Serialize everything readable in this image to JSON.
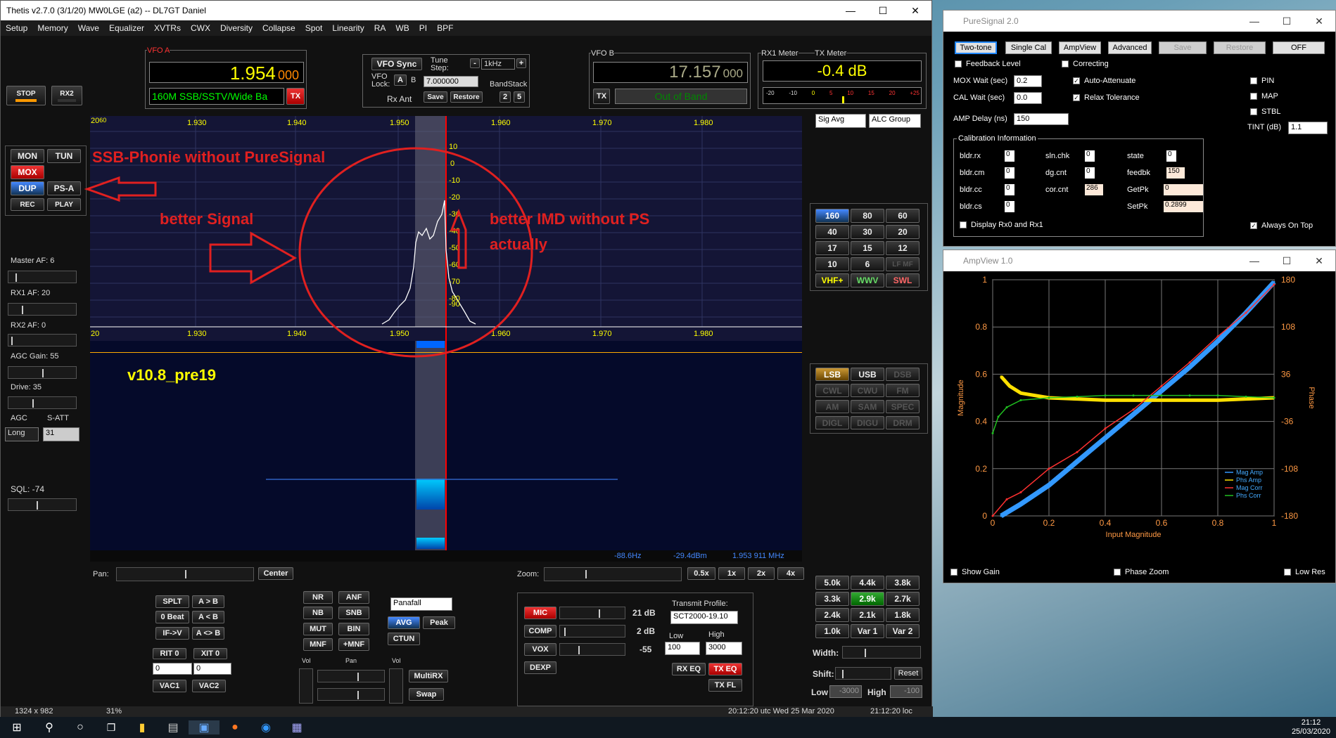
{
  "main": {
    "title": "Thetis v2.7.0 (3/1/20) MW0LGE (a2)  --  DL7GT Daniel",
    "menu": [
      "Setup",
      "Memory",
      "Wave",
      "Equalizer",
      "XVTRs",
      "CWX",
      "Diversity",
      "Collapse",
      "Spot",
      "Linearity",
      "RA",
      "WB",
      "PI",
      "BPF"
    ]
  },
  "vfoa": {
    "label": "VFO A",
    "freq": "1.954",
    "sub": "000",
    "band": "160M SSB/SSTV/Wide Ba",
    "tx": "TX"
  },
  "vfob": {
    "label": "VFO B",
    "freq": "17.157",
    "sub": "000",
    "band": "Out of Band",
    "tx": "TX"
  },
  "center": {
    "vfo_sync": "VFO Sync",
    "tune_step_label": "Tune Step:",
    "tune_step": "1kHz",
    "vfo_lock": "VFO Lock:",
    "a": "A",
    "b": "B",
    "freq_field": "7.000000",
    "bandstack": "BandStack",
    "rx_ant": "Rx Ant",
    "save": "Save",
    "restore": "Restore",
    "n2": "2",
    "n5": "5"
  },
  "meter": {
    "rx1": "RX1 Meter",
    "tx": "TX Meter",
    "value": "-0.4 dB",
    "scale": [
      "-20",
      "-10",
      "0",
      "5",
      "10",
      "15",
      "20",
      "+25"
    ],
    "sig": "Sig Avg",
    "alc": "ALC Group"
  },
  "left": {
    "stop": "STOP",
    "rx2": "RX2",
    "mon": "MON",
    "tun": "TUN",
    "mox": "MOX",
    "dup": "DUP",
    "psa": "PS-A",
    "rec": "REC",
    "play": "PLAY",
    "master_af": "Master AF:  6",
    "rx1_af": "RX1 AF:  20",
    "rx2_af": "RX2 AF:  0",
    "agc_gain": "AGC Gain:  55",
    "drive": "Drive:  35",
    "agc": "AGC",
    "satt": "S-ATT",
    "agc_val": "Long",
    "satt_val": "31",
    "sql": "SQL: -74"
  },
  "pan": {
    "freqs": [
      "1.930",
      "1.940",
      "1.950",
      "1.960",
      "1.970",
      "1.980"
    ],
    "dbs": [
      "10",
      "0",
      "-10",
      "-20",
      "-30",
      "-40",
      "-50",
      "-60",
      "-70",
      "-80",
      "-90"
    ],
    "corner_top": "20",
    "corner_top2": "60",
    "corner_bot": "20"
  },
  "annot": {
    "a1": "SSB-Phonie without PureSignal",
    "a2": "better Signal",
    "a3": "better IMD without PS",
    "a4": "actually",
    "version": "v10.8_pre19"
  },
  "readout": {
    "hz": "-88.6Hz",
    "dbm": "-29.4dBm",
    "mhz": "1.953 911 MHz"
  },
  "bands": [
    "160",
    "80",
    "60",
    "40",
    "30",
    "20",
    "17",
    "15",
    "12",
    "10",
    "6",
    "LF MF",
    "VHF+",
    "WWV",
    "SWL"
  ],
  "modes": [
    "LSB",
    "USB",
    "DSB",
    "CWL",
    "CWU",
    "FM",
    "AM",
    "SAM",
    "SPEC",
    "DIGL",
    "DIGU",
    "DRM"
  ],
  "filters": [
    "5.0k",
    "4.4k",
    "3.8k",
    "3.3k",
    "2.9k",
    "2.7k",
    "2.4k",
    "2.1k",
    "1.8k",
    "1.0k",
    "Var 1",
    "Var 2"
  ],
  "bottom": {
    "pan": "Pan:",
    "center": "Center",
    "zoom": "Zoom:",
    "z": [
      "0.5x",
      "1x",
      "2x",
      "4x"
    ],
    "splt": "SPLT",
    "atob": "A > B",
    "beat": "0 Beat",
    "altb": "A < B",
    "ifv": "IF->V",
    "aswap": "A <> B",
    "rit": "RIT",
    "rit0": "0",
    "xit": "XIT",
    "xit0": "0",
    "ritv": "0",
    "xitv": "0",
    "vac1": "VAC1",
    "vac2": "VAC2",
    "nr": "NR",
    "anf": "ANF",
    "nb": "NB",
    "snb": "SNB",
    "mut": "MUT",
    "bin": "BIN",
    "mnf": "MNF",
    "pmnf": "+MNF",
    "display": "Panafall",
    "avg": "AVG",
    "peak": "Peak",
    "ctun": "CTUN",
    "vol": "Vol",
    "panl": "Pan",
    "vol2": "Vol",
    "multirx": "MultiRX",
    "swap": "Swap",
    "mic": "MIC",
    "mic_db": "21 dB",
    "comp": "COMP",
    "comp_db": "2 dB",
    "vox": "VOX",
    "vox_db": "-55",
    "dexp": "DEXP",
    "tx_profile": "Transmit Profile:",
    "profile": "SCT2000-19.10",
    "low": "Low",
    "high": "High",
    "lowv": "100",
    "highv": "3000",
    "rxeq": "RX EQ",
    "txeq": "TX EQ",
    "txfl": "TX FL",
    "width": "Width:",
    "shift": "Shift:",
    "reset": "Reset",
    "flow": "Low",
    "flowv": "-3000",
    "fhigh": "High",
    "fhighv": "-100"
  },
  "status": {
    "res": "1324 x 982",
    "cpu": "31%",
    "utc": "20:12:20 utc   Wed 25 Mar 2020",
    "loc": "21:12:20 loc"
  },
  "taskbar": {
    "time": "21:12",
    "date": "25/03/2020"
  },
  "ps": {
    "title": "PureSignal 2.0",
    "buttons": [
      "Two-tone",
      "Single Cal",
      "AmpView",
      "Advanced",
      "Save",
      "Restore",
      "OFF"
    ],
    "feedback": "Feedback Level",
    "correcting": "Correcting",
    "mox_wait": "MOX Wait (sec)",
    "mox_wait_v": "0.2",
    "auto_att": "Auto-Attenuate",
    "cal_wait": "CAL Wait (sec)",
    "cal_wait_v": "0.0",
    "relax": "Relax Tolerance",
    "amp_delay": "AMP Delay (ns)",
    "amp_delay_v": "150",
    "pin": "PIN",
    "map": "MAP",
    "stbl": "STBL",
    "tint": "TINT (dB)",
    "tint_v": "1.1",
    "cal_info": "Calibration Information",
    "bldr_rx": "bldr.rx",
    "bldr_rx_v": "0",
    "bldr_cm": "bldr.cm",
    "bldr_cm_v": "0",
    "bldr_cc": "bldr.cc",
    "bldr_cc_v": "0",
    "bldr_cs": "bldr.cs",
    "bldr_cs_v": "0",
    "sln_chk": "sln.chk",
    "sln_chk_v": "0",
    "dg_cnt": "dg.cnt",
    "dg_cnt_v": "0",
    "cor_cnt": "cor.cnt",
    "cor_cnt_v": "286",
    "state": "state",
    "state_v": "0",
    "feedbk": "feedbk",
    "feedbk_v": "150",
    "getpk": "GetPk",
    "getpk_v": "0",
    "setpk": "SetPk",
    "setpk_v": "0.2899",
    "disp_rx": "Display Rx0 and Rx1",
    "always_top": "Always On Top"
  },
  "amp": {
    "title": "AmpView 1.0",
    "show_gain": "Show Gain",
    "phase_zoom": "Phase Zoom",
    "low_res": "Low Res"
  },
  "chart_data": {
    "type": "scatter",
    "xlabel": "Input Magnitude",
    "ylabel": "Magnitude",
    "y2label": "Phase",
    "xlim": [
      0,
      1
    ],
    "ylim": [
      0,
      1
    ],
    "y2lim": [
      -180,
      180
    ],
    "xticks": [
      "0",
      "0.2",
      "0.4",
      "0.6",
      "0.8",
      "1"
    ],
    "yticks": [
      "0",
      "0.2",
      "0.4",
      "0.6",
      "0.8",
      "1"
    ],
    "y2ticks": [
      "-180",
      "-108",
      "-36",
      "36",
      "108",
      "180"
    ],
    "legend": "bottom-right",
    "series": [
      {
        "name": "Mag Amp",
        "color": "#3399ff",
        "x": [
          0.03,
          0.1,
          0.2,
          0.3,
          0.4,
          0.5,
          0.6,
          0.7,
          0.8,
          0.9,
          1.0
        ],
        "y": [
          0.0,
          0.05,
          0.13,
          0.23,
          0.33,
          0.43,
          0.53,
          0.63,
          0.74,
          0.86,
          0.99
        ]
      },
      {
        "name": "Phs Amp",
        "color": "#ffe000",
        "x": [
          0.03,
          0.06,
          0.1,
          0.2,
          0.3,
          0.4,
          0.5,
          0.6,
          0.7,
          0.8,
          0.9,
          1.0
        ],
        "y": [
          0.59,
          0.55,
          0.52,
          0.5,
          0.495,
          0.49,
          0.49,
          0.49,
          0.49,
          0.49,
          0.495,
          0.5
        ]
      },
      {
        "name": "Mag Corr",
        "color": "#ff3030",
        "x": [
          0.0,
          0.05,
          0.1,
          0.2,
          0.3,
          0.4,
          0.5,
          0.6,
          0.7,
          0.8,
          0.9,
          1.0
        ],
        "y": [
          0.0,
          0.07,
          0.1,
          0.2,
          0.27,
          0.37,
          0.45,
          0.55,
          0.65,
          0.76,
          0.86,
          0.98
        ]
      },
      {
        "name": "Phs Corr",
        "color": "#20c020",
        "x": [
          0.0,
          0.02,
          0.05,
          0.1,
          0.2,
          0.3,
          0.4,
          0.5,
          0.6,
          0.7,
          0.8,
          0.9,
          1.0
        ],
        "y": [
          0.35,
          0.42,
          0.46,
          0.49,
          0.5,
          0.505,
          0.51,
          0.51,
          0.51,
          0.51,
          0.51,
          0.505,
          0.5
        ]
      }
    ]
  }
}
